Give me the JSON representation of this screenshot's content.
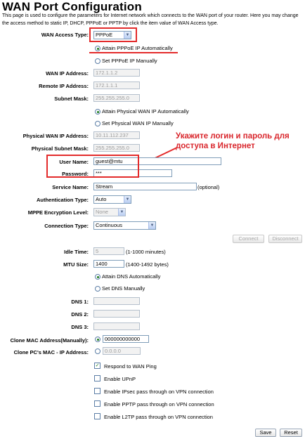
{
  "page": {
    "title": "WAN Port Configuration",
    "description": "This page is used to configure the parameters for Internet network which connects to the WAN port of your router. Here you may change the access method to static IP, DHCP, PPPoE or PPTP by click the item value of WAN Access type."
  },
  "wan_access": {
    "label": "WAN Access Type:",
    "value": "PPPoE"
  },
  "pppoe_ip": {
    "auto_label": "Attain PPPoE IP Automatically",
    "manual_label": "Set PPPoE IP Manually",
    "selected": "auto"
  },
  "wan_ip": {
    "label": "WAN IP Address:",
    "value": "172.1.1.2"
  },
  "remote_ip": {
    "label": "Remote IP Address:",
    "value": "172.1.1.1"
  },
  "subnet": {
    "label": "Subnet Mask:",
    "value": "255.255.255.0"
  },
  "physical_ip": {
    "auto_label": "Attain Physical WAN IP Automatically",
    "manual_label": "Set Physical WAN IP Manually",
    "selected": "auto"
  },
  "physical_wan_ip": {
    "label": "Physical WAN IP Address:",
    "value": "10.11.112.237"
  },
  "physical_subnet": {
    "label": "Physical Subnet Mask:",
    "value": "255.255.255.0"
  },
  "annotation": {
    "text": "Укажите логин и пароль для доступа в Интернет",
    "color": "#d9262c"
  },
  "username": {
    "label": "User Name:",
    "value": "guest@mtu"
  },
  "password": {
    "label": "Password:",
    "value": "***"
  },
  "service_name": {
    "label": "Service Name:",
    "value": "Stream",
    "hint": "(optional)"
  },
  "auth_type": {
    "label": "Authentication Type:",
    "value": "Auto"
  },
  "mppe": {
    "label": "MPPE Encryption Level:",
    "value": "None"
  },
  "connection_type": {
    "label": "Connection Type:",
    "value": "Continuous"
  },
  "connect_buttons": {
    "connect": "Connect",
    "disconnect": "Disconnect"
  },
  "idle_time": {
    "label": "Idle Time:",
    "value": "5",
    "hint": "(1-1000 minutes)"
  },
  "mtu": {
    "label": "MTU Size:",
    "value": "1400",
    "hint": "(1400-1492 bytes)"
  },
  "dns_mode": {
    "auto_label": "Attain DNS Automatically",
    "manual_label": "Set DNS Manually",
    "selected": "auto"
  },
  "dns": [
    {
      "label": "DNS 1:",
      "value": ""
    },
    {
      "label": "DNS 2:",
      "value": ""
    },
    {
      "label": "DNS 3:",
      "value": ""
    }
  ],
  "clone_mac": {
    "label": "Clone MAC Address(Manually):",
    "value": "000000000000"
  },
  "clone_pc_mac": {
    "label": "Clone PC's MAC - IP Address:",
    "value": "0.0.0.0"
  },
  "options": [
    {
      "label": "Respond to WAN Ping",
      "checked": true
    },
    {
      "label": "Enable UPnP",
      "checked": false
    },
    {
      "label": "Enable IPsec pass through on VPN connection",
      "checked": false
    },
    {
      "label": "Enable PPTP pass through on VPN connection",
      "checked": false
    },
    {
      "label": "Enable L2TP pass through on VPN connection",
      "checked": false
    }
  ],
  "buttons": {
    "save": "Save",
    "reset": "Reset"
  },
  "icons": {
    "dropdown": "chevron-down-icon",
    "check": "check-icon"
  },
  "colors": {
    "highlight": "#e32b2b",
    "input_border": "#7f9db9"
  }
}
